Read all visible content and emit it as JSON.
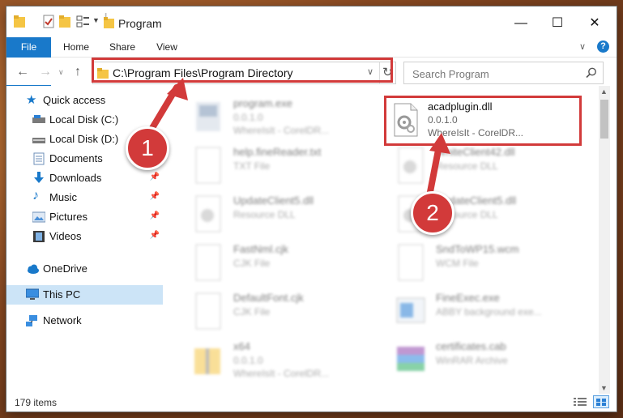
{
  "window": {
    "title": "Program",
    "controls": {
      "minimize": "—",
      "maximize": "☐",
      "close": "✕"
    }
  },
  "ribbon": {
    "tabs": [
      "File",
      "Home",
      "Share",
      "View"
    ]
  },
  "navigation": {
    "address_path": "C:\\Program Files\\Program Directory",
    "search_placeholder": "Search Program"
  },
  "sidebar": {
    "items": [
      {
        "label": "Quick access",
        "icon": "star-icon",
        "pinned": false
      },
      {
        "label": "Local Disk (C:)",
        "icon": "drive-icon",
        "pinned": false
      },
      {
        "label": "Local Disk (D:)",
        "icon": "drive-icon",
        "pinned": false
      },
      {
        "label": "Documents",
        "icon": "documents-icon",
        "pinned": true
      },
      {
        "label": "Downloads",
        "icon": "download-icon",
        "pinned": true
      },
      {
        "label": "Music",
        "icon": "music-icon",
        "pinned": true
      },
      {
        "label": "Pictures",
        "icon": "pictures-icon",
        "pinned": true
      },
      {
        "label": "Videos",
        "icon": "videos-icon",
        "pinned": true
      },
      {
        "label": "OneDrive",
        "icon": "cloud-icon",
        "pinned": false
      },
      {
        "label": "This PC",
        "icon": "pc-icon",
        "pinned": false,
        "selected": true
      },
      {
        "label": "Network",
        "icon": "network-icon",
        "pinned": false
      }
    ]
  },
  "files": {
    "highlighted": {
      "name": "acadplugin.dll",
      "version": "0.0.1.0",
      "company": "WhereIsIt - CorelDR..."
    },
    "others": [
      {
        "name": "program.exe",
        "line1": "0.0.1.0",
        "line2": "WhereIsIt - CorelDR..."
      },
      {
        "name": "help.fineReader.txt",
        "line1": "TXT File",
        "line2": ""
      },
      {
        "name": "WhiteClient42.dll",
        "line1": "Resource DLL",
        "line2": ""
      },
      {
        "name": "UpdateClient5.dll",
        "line1": "Resource DLL",
        "line2": ""
      },
      {
        "name": "UpdateClient5.dll",
        "line1": "Resource DLL",
        "line2": ""
      },
      {
        "name": "FastNml.cjk",
        "line1": "CJK File",
        "line2": ""
      },
      {
        "name": "SndToWP15.wcm",
        "line1": "WCM File",
        "line2": ""
      },
      {
        "name": "DefaultFont.cjk",
        "line1": "CJK File",
        "line2": ""
      },
      {
        "name": "FineExec.exe",
        "line1": "ABBY background exe...",
        "line2": ""
      },
      {
        "name": "x64",
        "line1": "0.0.1.0",
        "line2": "WhereIsIt - CorelDR..."
      },
      {
        "name": "certificates.cab",
        "line1": "WinRAR Archive",
        "line2": ""
      }
    ]
  },
  "status": {
    "item_count": "179 items"
  },
  "callouts": {
    "one": "1",
    "two": "2"
  },
  "colors": {
    "accent": "#1979ca",
    "highlight_red": "#d23a3a",
    "selected_bg": "#cce4f7"
  }
}
